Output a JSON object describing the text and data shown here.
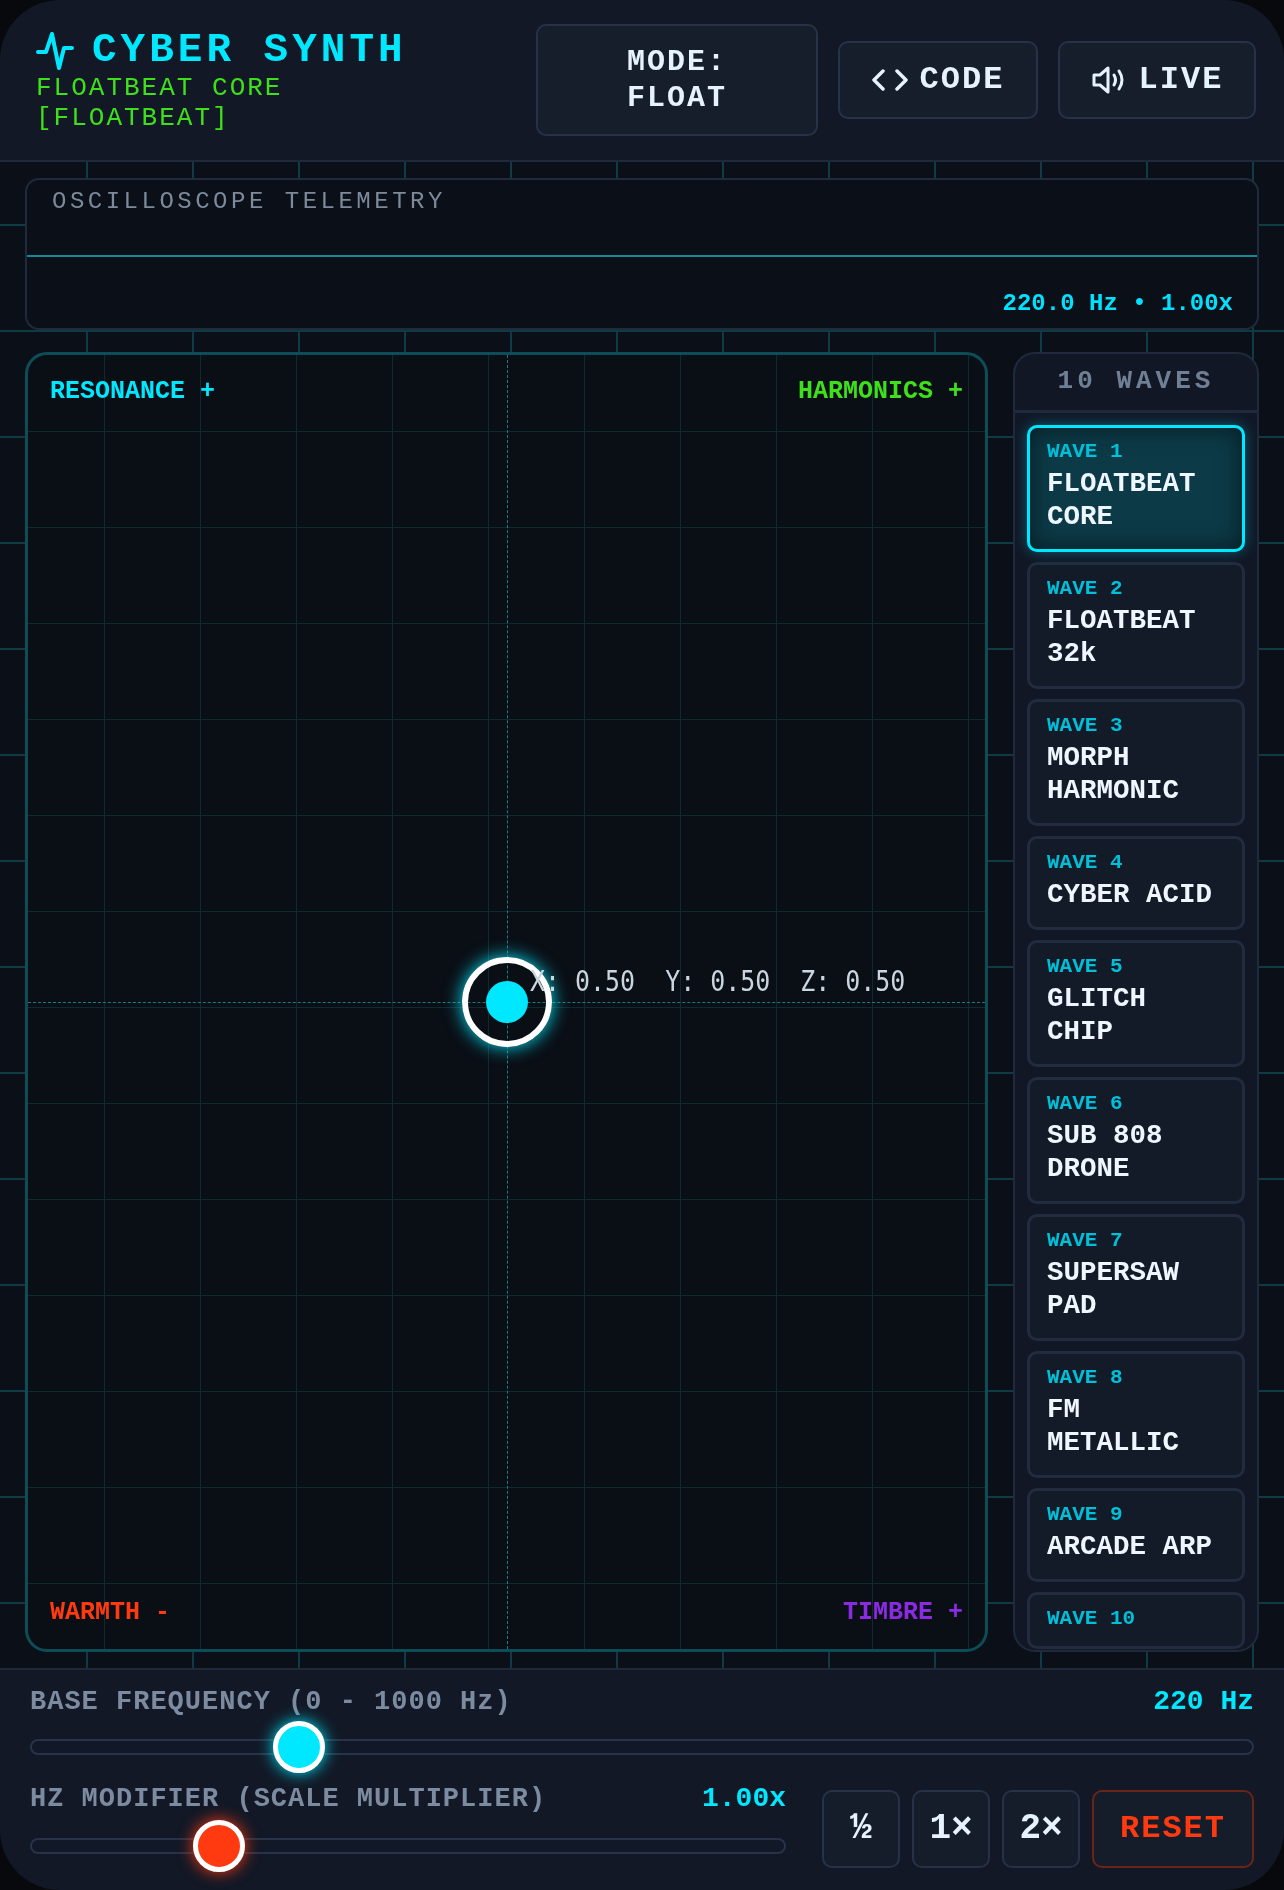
{
  "header": {
    "title": "CYBER SYNTH",
    "subtitle": "FLOATBEAT CORE [FLOATBEAT]",
    "mode_button": "MODE: FLOAT",
    "code_button": "CODE",
    "live_button": "LIVE"
  },
  "telemetry": {
    "title": "OSCILLOSCOPE TELEMETRY",
    "readout": "220.0 Hz • 1.00x"
  },
  "pad": {
    "top_left": "RESONANCE +",
    "top_right": "HARMONICS +",
    "bottom_left": "WARMTH -",
    "bottom_right": "TIMBRE +",
    "readout": "X: 0.50  Y: 0.50  Z: 0.50"
  },
  "waves": {
    "title": "10 WAVES",
    "items": [
      {
        "label": "WAVE 1",
        "name": "FLOATBEAT CORE",
        "selected": true
      },
      {
        "label": "WAVE 2",
        "name": "FLOATBEAT 32k",
        "selected": false
      },
      {
        "label": "WAVE 3",
        "name": "MORPH HARMONIC",
        "selected": false
      },
      {
        "label": "WAVE 4",
        "name": "CYBER ACID",
        "selected": false
      },
      {
        "label": "WAVE 5",
        "name": "GLITCH CHIP",
        "selected": false
      },
      {
        "label": "WAVE 6",
        "name": "SUB 808 DRONE",
        "selected": false
      },
      {
        "label": "WAVE 7",
        "name": "SUPERSAW PAD",
        "selected": false
      },
      {
        "label": "WAVE 8",
        "name": "FM METALLIC",
        "selected": false
      },
      {
        "label": "WAVE 9",
        "name": "ARCADE ARP",
        "selected": false
      },
      {
        "label": "WAVE 10",
        "selected": false
      }
    ]
  },
  "base_frequency": {
    "label": "BASE FREQUENCY (0 - 1000 Hz)",
    "value": "220 Hz",
    "level": 0.22
  },
  "hz_modifier": {
    "label": "HZ MODIFIER (SCALE MULTIPLIER)",
    "value": "1.00x",
    "level": 0.25,
    "buttons": [
      "½",
      "1×",
      "2×"
    ],
    "reset": "RESET"
  }
}
